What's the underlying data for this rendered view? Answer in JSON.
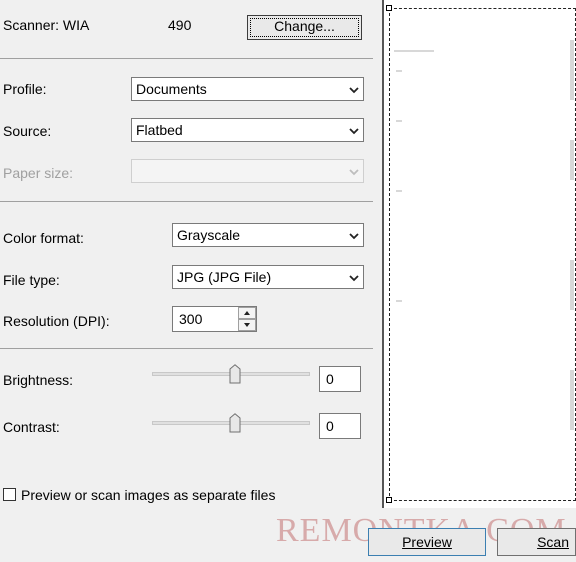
{
  "scanner": {
    "label": "Scanner: WIA",
    "model_suffix": "490",
    "change_button": "Change..."
  },
  "profile": {
    "label": "Profile:",
    "value": "Documents"
  },
  "source": {
    "label": "Source:",
    "value": "Flatbed"
  },
  "paper_size": {
    "label": "Paper size:",
    "value": ""
  },
  "color_format": {
    "label": "Color format:",
    "value": "Grayscale"
  },
  "file_type": {
    "label": "File type:",
    "value": "JPG (JPG File)"
  },
  "resolution": {
    "label": "Resolution (DPI):",
    "value": "300"
  },
  "brightness": {
    "label": "Brightness:",
    "value": "0",
    "level_fraction": 0.5
  },
  "contrast": {
    "label": "Contrast:",
    "value": "0",
    "level_fraction": 0.5
  },
  "separate_files": {
    "label": "Preview or scan images as separate files",
    "checked": false
  },
  "buttons": {
    "preview": "Preview",
    "scan": "Scan"
  },
  "watermark": "REMONTKA.COM",
  "colors": {
    "accent_border": "#3c7fb1",
    "background": "#f0f0f0"
  },
  "icons": [
    "chevron-down-icon",
    "spin-up-icon",
    "spin-down-icon",
    "slider-thumb-icon",
    "checkbox-icon"
  ]
}
